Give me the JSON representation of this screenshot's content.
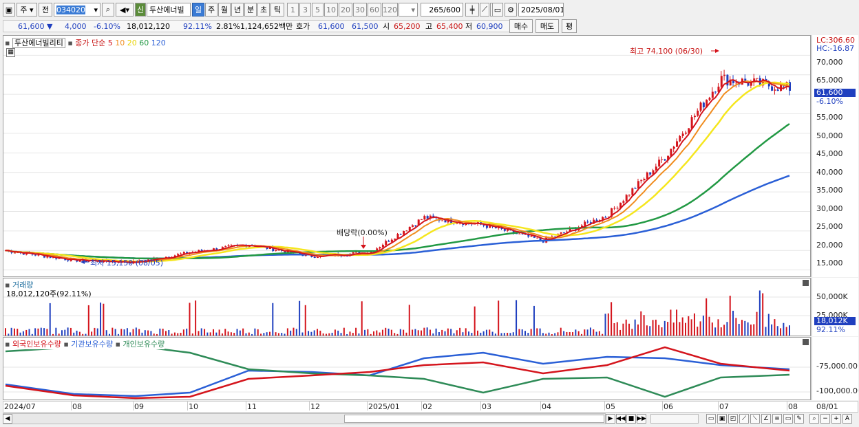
{
  "toolbar": {
    "mode": "주",
    "prev_label": "전",
    "code": "034020",
    "new_badge": "신",
    "name": "두산에너빌",
    "periods": [
      "일",
      "주",
      "월",
      "년",
      "분",
      "초",
      "틱"
    ],
    "intervals": [
      "1",
      "3",
      "5",
      "10",
      "20",
      "30",
      "60",
      "120"
    ],
    "count": "265",
    "count_total": "/600",
    "date": "2025/08/01"
  },
  "quote": {
    "price": "61,600",
    "change": "4,000",
    "change_pct": "-6.10%",
    "volume": "18,012,120",
    "vol_ratio": "92.11%",
    "turnover_pct": "2.81%",
    "value": "1,124,652백만",
    "ask_label": "호가",
    "ask": "61,600",
    "bid": "61,500",
    "open_label": "시",
    "open": "65,200",
    "high_label": "고",
    "high": "65,400",
    "low_label": "저",
    "low": "60,900",
    "buy": "매수",
    "sell": "매도",
    "eval": "평"
  },
  "main_chart": {
    "stock_label": "두산에너빌리티",
    "indicator": "종가 단순",
    "ma_periods": [
      "5",
      "10",
      "20",
      "60",
      "120"
    ],
    "ma_colors": [
      "#d4141c",
      "#f08c1e",
      "#f5e61e",
      "#229944",
      "#2a5fd6"
    ],
    "lc": "LC:306.60",
    "hc": "HC:-16.87",
    "price_tag": "61,600",
    "pct_tag": "-6.10%",
    "y_ticks": [
      "70,000",
      "65,000",
      "60,000",
      "55,000",
      "50,000",
      "45,000",
      "40,000",
      "35,000",
      "30,000",
      "25,000",
      "20,000",
      "15,000"
    ],
    "high_note": "최고 74,100 (06/30)",
    "low_note": "최저 15,150 (08/05)",
    "div_note": "배당락(0.00%)"
  },
  "volume_chart": {
    "title": "거래량",
    "value": "18,012,120주(92.11%)",
    "y_ticks": [
      "50,000K",
      "25,000K"
    ],
    "vol_tag": "18,012K",
    "pct_tag": "92.11%"
  },
  "holdings_chart": {
    "legends": [
      "외국인보유수량",
      "기관보유수량",
      "개인보유수량"
    ],
    "colors": [
      "#d4141c",
      "#2a5fd6",
      "#2e8b57"
    ],
    "y_ticks": [
      "-75,000.00",
      "-100,000.00"
    ]
  },
  "x_axis": {
    "labels": [
      "2024/07",
      "08",
      "09",
      "10",
      "11",
      "12",
      "2025/01",
      "02",
      "03",
      "04",
      "05",
      "06",
      "07",
      "08",
      "08/01"
    ]
  },
  "chart_data": {
    "type": "candlestick",
    "title": "두산에너빌리티",
    "x_range": [
      "2024/07",
      "2025/08/01"
    ],
    "ylim": [
      13000,
      75000
    ],
    "close_approx": [
      {
        "x": "2024/07",
        "y": 20000
      },
      {
        "x": "08",
        "y": 17500
      },
      {
        "x": "09",
        "y": 17000
      },
      {
        "x": "10",
        "y": 19500
      },
      {
        "x": "11",
        "y": 21500
      },
      {
        "x": "12",
        "y": 18500
      },
      {
        "x": "2025/01",
        "y": 19500
      },
      {
        "x": "02",
        "y": 28500
      },
      {
        "x": "03",
        "y": 26500
      },
      {
        "x": "04",
        "y": 22500
      },
      {
        "x": "05",
        "y": 29000
      },
      {
        "x": "06",
        "y": 44000
      },
      {
        "x": "07",
        "y": 64000
      },
      {
        "x": "08",
        "y": 61600
      }
    ],
    "annotations": [
      {
        "label": "최고 74,100 (06/30)",
        "x": "06/30",
        "y": 74100
      },
      {
        "label": "최저 15,150 (08/05)",
        "x": "08/05",
        "y": 15150
      },
      {
        "label": "배당락(0.00%)",
        "x": "12/27"
      }
    ]
  }
}
